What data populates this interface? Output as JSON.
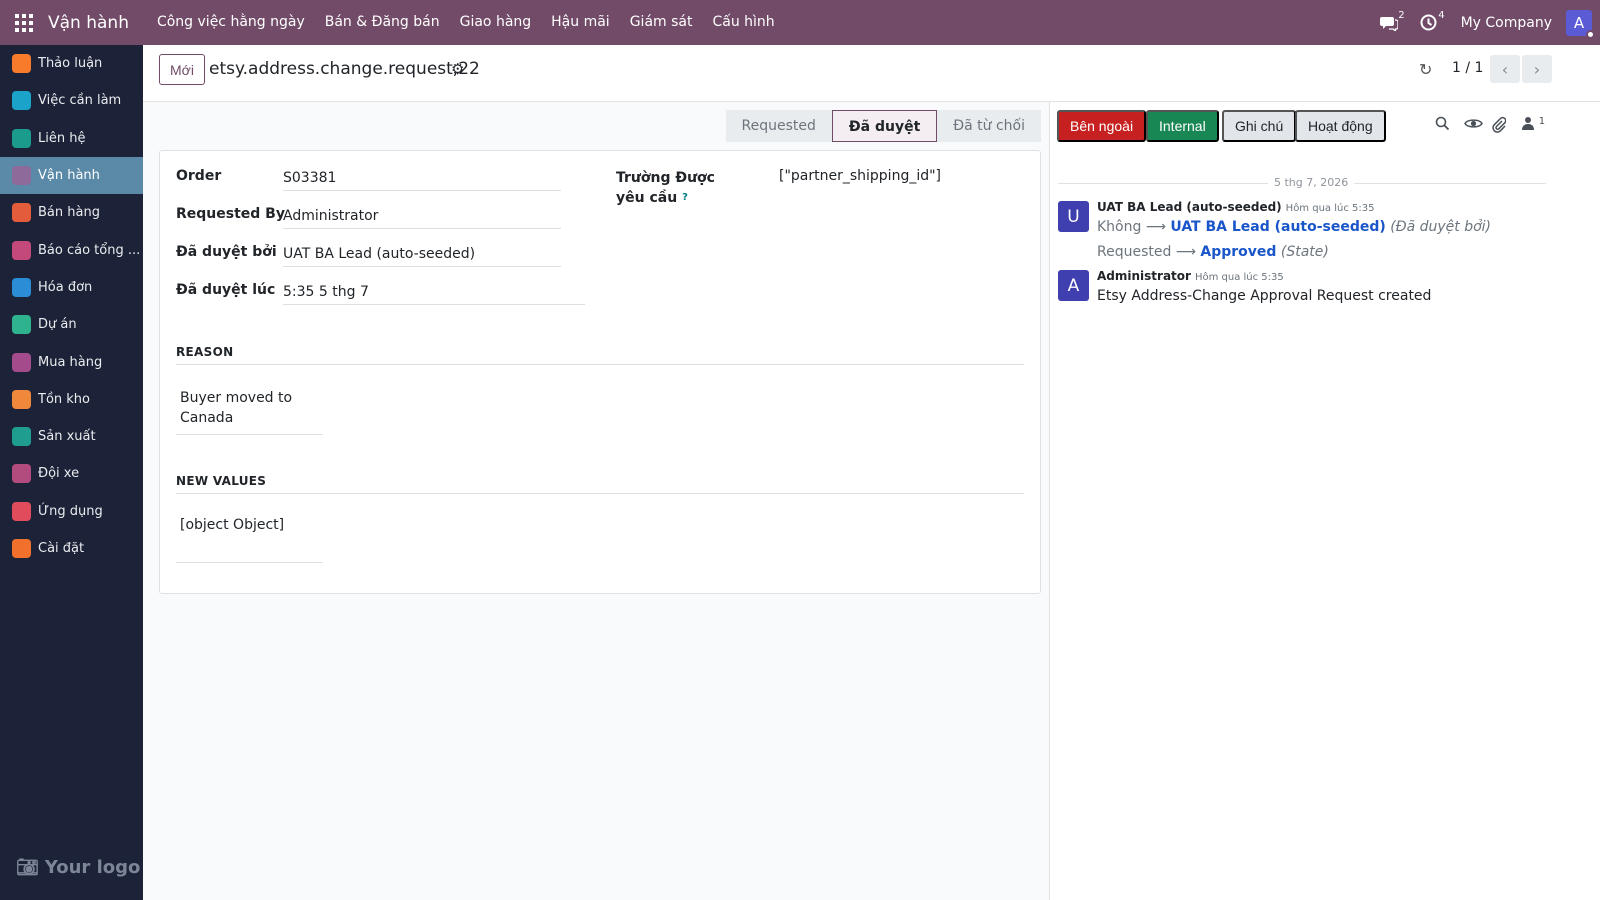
{
  "navbar": {
    "app_name": "Vận hành",
    "menu": [
      "Công việc hằng ngày",
      "Bán & Đăng bán",
      "Giao hàng",
      "Hậu mãi",
      "Giám sát",
      "Cấu hình"
    ],
    "messages_count": "2",
    "activities_count": "4",
    "company": "My Company",
    "avatar_letter": "A",
    "brand_color": "#714b67"
  },
  "sidebar": {
    "items": [
      {
        "label": "Thảo luận",
        "icon": "discuss-icon",
        "color": "#f77b2b"
      },
      {
        "label": "Việc cần làm",
        "icon": "todo-icon",
        "color": "#1ba3c9"
      },
      {
        "label": "Liên hệ",
        "icon": "contacts-icon",
        "color": "#1a9b8c"
      },
      {
        "label": "Vận hành",
        "icon": "operations-icon",
        "color": "#8e6a9a"
      },
      {
        "label": "Bán hàng",
        "icon": "sales-icon",
        "color": "#e35d3d"
      },
      {
        "label": "Báo cáo tổng ...",
        "icon": "reports-icon",
        "color": "#c4497b"
      },
      {
        "label": "Hóa đơn",
        "icon": "invoice-icon",
        "color": "#2a8dd6"
      },
      {
        "label": "Dự án",
        "icon": "project-icon",
        "color": "#2fb38f"
      },
      {
        "label": "Mua hàng",
        "icon": "purchase-icon",
        "color": "#a44b8b"
      },
      {
        "label": "Tồn kho",
        "icon": "inventory-icon",
        "color": "#f0883c"
      },
      {
        "label": "Sản xuất",
        "icon": "manufacturing-icon",
        "color": "#1f9e8f"
      },
      {
        "label": "Đội xe",
        "icon": "fleet-icon",
        "color": "#b24b7e"
      },
      {
        "label": "Ứng dụng",
        "icon": "apps-icon",
        "color": "#e04c5c"
      },
      {
        "label": "Cài đặt",
        "icon": "settings-icon",
        "color": "#f0702c"
      }
    ],
    "active_index": 3,
    "logo_text": "Your logo"
  },
  "control_panel": {
    "new_label": "Mới",
    "record_title": "etsy.address.change.request,22",
    "pager": "1 / 1"
  },
  "statusbar": {
    "stages": [
      "Requested",
      "Đã duyệt",
      "Đã từ chối"
    ],
    "current": "Đã duyệt"
  },
  "form": {
    "order_label": "Order",
    "order_value": "S03381",
    "requested_by_label": "Requested By",
    "requested_by_value": "Administrator",
    "approved_by_label": "Đã duyệt bởi",
    "approved_by_value": "UAT BA Lead (auto-seeded)",
    "approved_at_label": "Đã duyệt lúc",
    "approved_at_value": "5:35 5 thg 7",
    "requested_fields_label": "Trường Được yêu cầu",
    "requested_fields_help": "?",
    "requested_fields_value": "[\"partner_shipping_id\"]",
    "reason_title": "REASON",
    "reason_value": "Buyer moved to Canada",
    "new_values_title": "NEW VALUES",
    "new_values_value": "[object Object]"
  },
  "chatter": {
    "buttons": {
      "external": "Bên ngoài",
      "internal": "Internal",
      "note": "Ghi chú",
      "activity": "Hoạt động"
    },
    "followers_count": "1",
    "date_separator": "5 thg 7, 2026",
    "messages": [
      {
        "avatar": "U",
        "author": "UAT BA Lead (auto-seeded)",
        "time": "Hôm qua lúc 5:35",
        "tracking": [
          {
            "old": "Không",
            "new": "UAT BA Lead (auto-seeded)",
            "field": "(Đã duyệt bởi)"
          },
          {
            "old": "Requested",
            "new": "Approved",
            "field": "(State)"
          }
        ]
      },
      {
        "avatar": "A",
        "author": "Administrator",
        "time": "Hôm qua lúc 5:35",
        "body": "Etsy Address-Change Approval Request created"
      }
    ]
  }
}
